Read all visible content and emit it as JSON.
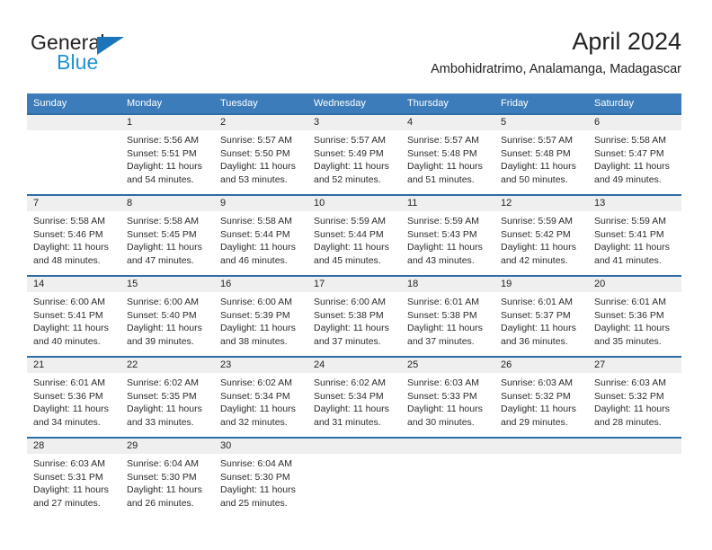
{
  "brand": {
    "name_part1": "General",
    "name_part2": "Blue",
    "triangle_icon": "triangle-icon",
    "color_dark": "#231f20",
    "color_blue": "#2191d4"
  },
  "header": {
    "title": "April 2024",
    "subtitle": "Ambohidratrimo, Analamanga, Madagascar"
  },
  "calendar": {
    "header_bg": "#3c7cba",
    "band_bg": "#efefef",
    "separator_color": "#2e6da4",
    "weekdays": [
      "Sunday",
      "Monday",
      "Tuesday",
      "Wednesday",
      "Thursday",
      "Friday",
      "Saturday"
    ],
    "weeks": [
      [
        {
          "day": "",
          "sunrise": "",
          "sunset": "",
          "daylight": ""
        },
        {
          "day": "1",
          "sunrise": "Sunrise: 5:56 AM",
          "sunset": "Sunset: 5:51 PM",
          "daylight": "Daylight: 11 hours and 54 minutes."
        },
        {
          "day": "2",
          "sunrise": "Sunrise: 5:57 AM",
          "sunset": "Sunset: 5:50 PM",
          "daylight": "Daylight: 11 hours and 53 minutes."
        },
        {
          "day": "3",
          "sunrise": "Sunrise: 5:57 AM",
          "sunset": "Sunset: 5:49 PM",
          "daylight": "Daylight: 11 hours and 52 minutes."
        },
        {
          "day": "4",
          "sunrise": "Sunrise: 5:57 AM",
          "sunset": "Sunset: 5:48 PM",
          "daylight": "Daylight: 11 hours and 51 minutes."
        },
        {
          "day": "5",
          "sunrise": "Sunrise: 5:57 AM",
          "sunset": "Sunset: 5:48 PM",
          "daylight": "Daylight: 11 hours and 50 minutes."
        },
        {
          "day": "6",
          "sunrise": "Sunrise: 5:58 AM",
          "sunset": "Sunset: 5:47 PM",
          "daylight": "Daylight: 11 hours and 49 minutes."
        }
      ],
      [
        {
          "day": "7",
          "sunrise": "Sunrise: 5:58 AM",
          "sunset": "Sunset: 5:46 PM",
          "daylight": "Daylight: 11 hours and 48 minutes."
        },
        {
          "day": "8",
          "sunrise": "Sunrise: 5:58 AM",
          "sunset": "Sunset: 5:45 PM",
          "daylight": "Daylight: 11 hours and 47 minutes."
        },
        {
          "day": "9",
          "sunrise": "Sunrise: 5:58 AM",
          "sunset": "Sunset: 5:44 PM",
          "daylight": "Daylight: 11 hours and 46 minutes."
        },
        {
          "day": "10",
          "sunrise": "Sunrise: 5:59 AM",
          "sunset": "Sunset: 5:44 PM",
          "daylight": "Daylight: 11 hours and 45 minutes."
        },
        {
          "day": "11",
          "sunrise": "Sunrise: 5:59 AM",
          "sunset": "Sunset: 5:43 PM",
          "daylight": "Daylight: 11 hours and 43 minutes."
        },
        {
          "day": "12",
          "sunrise": "Sunrise: 5:59 AM",
          "sunset": "Sunset: 5:42 PM",
          "daylight": "Daylight: 11 hours and 42 minutes."
        },
        {
          "day": "13",
          "sunrise": "Sunrise: 5:59 AM",
          "sunset": "Sunset: 5:41 PM",
          "daylight": "Daylight: 11 hours and 41 minutes."
        }
      ],
      [
        {
          "day": "14",
          "sunrise": "Sunrise: 6:00 AM",
          "sunset": "Sunset: 5:41 PM",
          "daylight": "Daylight: 11 hours and 40 minutes."
        },
        {
          "day": "15",
          "sunrise": "Sunrise: 6:00 AM",
          "sunset": "Sunset: 5:40 PM",
          "daylight": "Daylight: 11 hours and 39 minutes."
        },
        {
          "day": "16",
          "sunrise": "Sunrise: 6:00 AM",
          "sunset": "Sunset: 5:39 PM",
          "daylight": "Daylight: 11 hours and 38 minutes."
        },
        {
          "day": "17",
          "sunrise": "Sunrise: 6:00 AM",
          "sunset": "Sunset: 5:38 PM",
          "daylight": "Daylight: 11 hours and 37 minutes."
        },
        {
          "day": "18",
          "sunrise": "Sunrise: 6:01 AM",
          "sunset": "Sunset: 5:38 PM",
          "daylight": "Daylight: 11 hours and 37 minutes."
        },
        {
          "day": "19",
          "sunrise": "Sunrise: 6:01 AM",
          "sunset": "Sunset: 5:37 PM",
          "daylight": "Daylight: 11 hours and 36 minutes."
        },
        {
          "day": "20",
          "sunrise": "Sunrise: 6:01 AM",
          "sunset": "Sunset: 5:36 PM",
          "daylight": "Daylight: 11 hours and 35 minutes."
        }
      ],
      [
        {
          "day": "21",
          "sunrise": "Sunrise: 6:01 AM",
          "sunset": "Sunset: 5:36 PM",
          "daylight": "Daylight: 11 hours and 34 minutes."
        },
        {
          "day": "22",
          "sunrise": "Sunrise: 6:02 AM",
          "sunset": "Sunset: 5:35 PM",
          "daylight": "Daylight: 11 hours and 33 minutes."
        },
        {
          "day": "23",
          "sunrise": "Sunrise: 6:02 AM",
          "sunset": "Sunset: 5:34 PM",
          "daylight": "Daylight: 11 hours and 32 minutes."
        },
        {
          "day": "24",
          "sunrise": "Sunrise: 6:02 AM",
          "sunset": "Sunset: 5:34 PM",
          "daylight": "Daylight: 11 hours and 31 minutes."
        },
        {
          "day": "25",
          "sunrise": "Sunrise: 6:03 AM",
          "sunset": "Sunset: 5:33 PM",
          "daylight": "Daylight: 11 hours and 30 minutes."
        },
        {
          "day": "26",
          "sunrise": "Sunrise: 6:03 AM",
          "sunset": "Sunset: 5:32 PM",
          "daylight": "Daylight: 11 hours and 29 minutes."
        },
        {
          "day": "27",
          "sunrise": "Sunrise: 6:03 AM",
          "sunset": "Sunset: 5:32 PM",
          "daylight": "Daylight: 11 hours and 28 minutes."
        }
      ],
      [
        {
          "day": "28",
          "sunrise": "Sunrise: 6:03 AM",
          "sunset": "Sunset: 5:31 PM",
          "daylight": "Daylight: 11 hours and 27 minutes."
        },
        {
          "day": "29",
          "sunrise": "Sunrise: 6:04 AM",
          "sunset": "Sunset: 5:30 PM",
          "daylight": "Daylight: 11 hours and 26 minutes."
        },
        {
          "day": "30",
          "sunrise": "Sunrise: 6:04 AM",
          "sunset": "Sunset: 5:30 PM",
          "daylight": "Daylight: 11 hours and 25 minutes."
        },
        {
          "day": "",
          "sunrise": "",
          "sunset": "",
          "daylight": ""
        },
        {
          "day": "",
          "sunrise": "",
          "sunset": "",
          "daylight": ""
        },
        {
          "day": "",
          "sunrise": "",
          "sunset": "",
          "daylight": ""
        },
        {
          "day": "",
          "sunrise": "",
          "sunset": "",
          "daylight": ""
        }
      ]
    ]
  }
}
